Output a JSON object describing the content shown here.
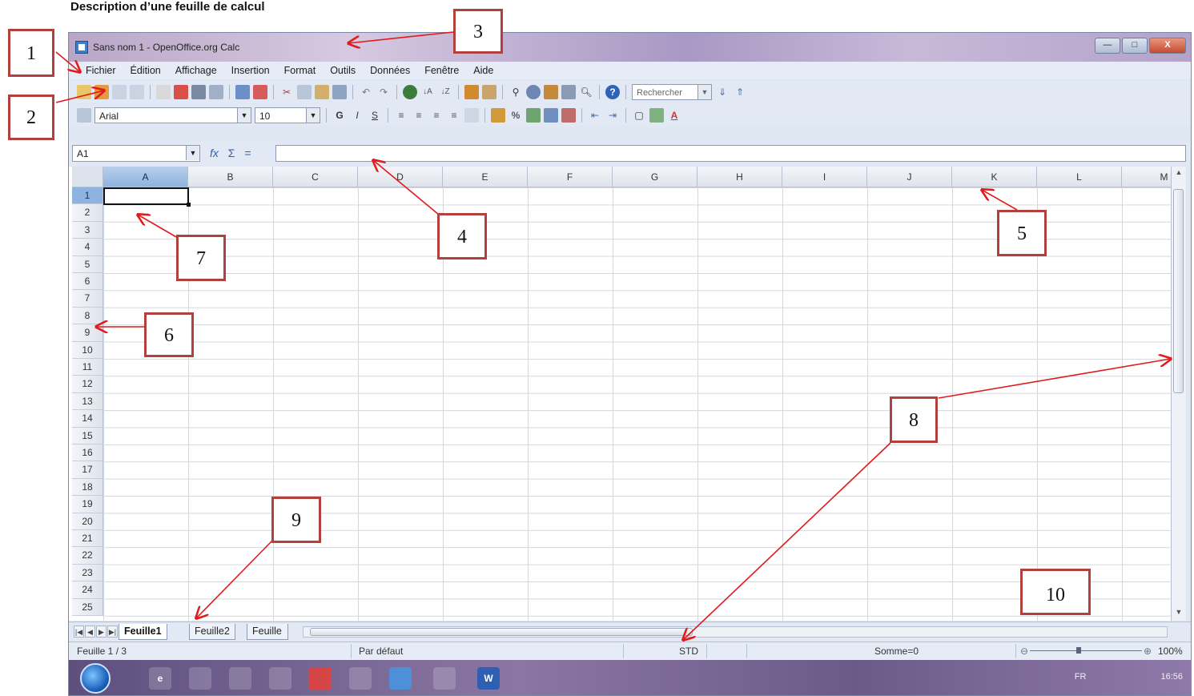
{
  "doc_title": "Description d’une feuille de calcul",
  "window": {
    "title": "Sans nom 1 - OpenOffice.org Calc",
    "controls": {
      "minimize": "—",
      "maximize": "□",
      "close": "X"
    }
  },
  "menubar": [
    "Fichier",
    "Édition",
    "Affichage",
    "Insertion",
    "Format",
    "Outils",
    "Données",
    "Fenêtre",
    "Aide"
  ],
  "toolbar_formatting": {
    "font_name": "Arial",
    "font_size": "10",
    "bold": "G",
    "italic": "I",
    "underline": "S"
  },
  "toolbar_standard": {
    "search_placeholder": "Rechercher"
  },
  "formula_bar": {
    "name_box": "A1",
    "function_wizard": "fx",
    "sum": "Σ",
    "equals": "=",
    "value": ""
  },
  "columns": [
    "A",
    "B",
    "C",
    "D",
    "E",
    "F",
    "G",
    "H",
    "I",
    "J",
    "K",
    "L",
    "M"
  ],
  "rows": [
    "1",
    "2",
    "3",
    "4",
    "5",
    "6",
    "7",
    "8",
    "9",
    "10",
    "11",
    "12",
    "13",
    "14",
    "15",
    "16",
    "17",
    "18",
    "19",
    "20",
    "21",
    "22",
    "23",
    "24",
    "25"
  ],
  "active_cell": "A1",
  "sheet_tabs": [
    "Feuille1",
    "Feuille2",
    "Feuille"
  ],
  "status_bar": {
    "sheet": "Feuille 1 / 3",
    "page_style": "Par défaut",
    "mode": "STD",
    "sum": "Somme=0",
    "zoom": "100%"
  },
  "taskbar": {
    "language": "FR",
    "time": "16:56"
  },
  "annotations": [
    "1",
    "2",
    "3",
    "4",
    "5",
    "6",
    "7",
    "8",
    "9",
    "10"
  ],
  "colors": {
    "annotation_border": "#b0413e",
    "arrow": "#e11b1b",
    "selected_header": "#8eb3e0"
  }
}
